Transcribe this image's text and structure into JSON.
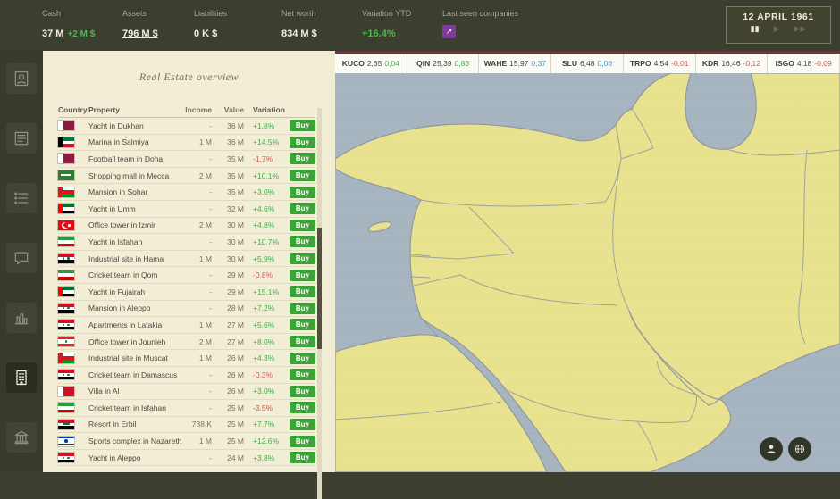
{
  "topbar": {
    "stats": [
      {
        "label": "Cash",
        "value": "37 M",
        "extra": "+2 M $"
      },
      {
        "label": "Assets",
        "value": "796 M $",
        "underline": true
      },
      {
        "label": "Liabilities",
        "value": "0 K $"
      },
      {
        "label": "Net worth",
        "value": "834 M $"
      },
      {
        "label": "Variation YTD",
        "value": "+16.4%",
        "positive": true
      },
      {
        "label": "Last seen companies",
        "button_icon": "↗"
      }
    ],
    "date": "12 APRIL 1961",
    "time_controls": {
      "pause": "▮▮",
      "play": "▶",
      "fast_forward": "▶▶"
    }
  },
  "ticker": [
    {
      "name": "KUCO",
      "price": "2,65",
      "change": "0,04",
      "color": "#3fae49"
    },
    {
      "name": "QIN",
      "price": "25,39",
      "change": "0,83",
      "color": "#3fae49"
    },
    {
      "name": "WAHE",
      "price": "15,97",
      "change": "0,37",
      "color": "#4596c7"
    },
    {
      "name": "SLU",
      "price": "6,48",
      "change": "0,06",
      "color": "#4596c7"
    },
    {
      "name": "TRPO",
      "price": "4,54",
      "change": "-0,01",
      "color": "#cd5a4e"
    },
    {
      "name": "KDR",
      "price": "16,46",
      "change": "-0,12",
      "color": "#cd5a4e"
    },
    {
      "name": "ISGO",
      "price": "4,18",
      "change": "-0,09",
      "color": "#cd5a4e"
    }
  ],
  "sidebar": {
    "items": [
      {
        "name": "profile",
        "icon": "portrait",
        "active": false
      },
      {
        "name": "news",
        "icon": "news",
        "active": false
      },
      {
        "name": "contracts",
        "icon": "list",
        "active": false
      },
      {
        "name": "messages",
        "icon": "chat",
        "active": false
      },
      {
        "name": "markets",
        "icon": "chart",
        "active": false
      },
      {
        "name": "real-estate",
        "icon": "building",
        "active": true
      },
      {
        "name": "bank",
        "icon": "bank",
        "active": false
      }
    ]
  },
  "panel": {
    "title": "Real Estate overview",
    "columns": [
      "Country",
      "Property",
      "Income",
      "Value",
      "Variation"
    ],
    "buy_label": "Buy",
    "rows": [
      {
        "flag": "qatar",
        "property": "Yacht in Dukhan",
        "income": "-",
        "value": "36 M",
        "variation": "+1.8%"
      },
      {
        "flag": "kuwait",
        "property": "Marina in Salmiya",
        "income": "1 M",
        "value": "36 M",
        "variation": "+14.5%"
      },
      {
        "flag": "qatar",
        "property": "Football team in Doha",
        "income": "-",
        "value": "35 M",
        "variation": "-1.7%"
      },
      {
        "flag": "saudi",
        "property": "Shopping mall in Mecca",
        "income": "2 M",
        "value": "35 M",
        "variation": "+10.1%"
      },
      {
        "flag": "oman",
        "property": "Mansion in Sohar",
        "income": "-",
        "value": "35 M",
        "variation": "+3.0%"
      },
      {
        "flag": "uae",
        "property": "Yacht in Umm",
        "income": "-",
        "value": "32 M",
        "variation": "+4.6%"
      },
      {
        "flag": "turkey",
        "property": "Office tower in Izmir",
        "income": "2 M",
        "value": "30 M",
        "variation": "+4.8%"
      },
      {
        "flag": "iran",
        "property": "Yacht in Isfahan",
        "income": "-",
        "value": "30 M",
        "variation": "+10.7%"
      },
      {
        "flag": "syria",
        "property": "Industrial site in Hama",
        "income": "1 M",
        "value": "30 M",
        "variation": "+5.9%"
      },
      {
        "flag": "iran",
        "property": "Cricket team in Qom",
        "income": "-",
        "value": "29 M",
        "variation": "-0.8%"
      },
      {
        "flag": "uae",
        "property": "Yacht in Fujairah",
        "income": "-",
        "value": "29 M",
        "variation": "+15.1%"
      },
      {
        "flag": "syria",
        "property": "Mansion in Aleppo",
        "income": "-",
        "value": "28 M",
        "variation": "+7.2%"
      },
      {
        "flag": "syria",
        "property": "Apartments in Latakia",
        "income": "1 M",
        "value": "27 M",
        "variation": "+5.6%"
      },
      {
        "flag": "lebanon",
        "property": "Office tower in Jounieh",
        "income": "2 M",
        "value": "27 M",
        "variation": "+8.0%"
      },
      {
        "flag": "oman",
        "property": "Industrial site in Muscat",
        "income": "1 M",
        "value": "26 M",
        "variation": "+4.3%"
      },
      {
        "flag": "syria",
        "property": "Cricket team in Damascus",
        "income": "-",
        "value": "26 M",
        "variation": "-0.3%"
      },
      {
        "flag": "bahrain",
        "property": "Villa in Al",
        "income": "-",
        "value": "26 M",
        "variation": "+3.0%"
      },
      {
        "flag": "iran",
        "property": "Cricket team in Isfahan",
        "income": "-",
        "value": "25 M",
        "variation": "-3.5%"
      },
      {
        "flag": "iraq",
        "property": "Resort in Erbil",
        "income": "738 K",
        "value": "25 M",
        "variation": "+7.7%"
      },
      {
        "flag": "israel",
        "property": "Sports complex in Nazareth",
        "income": "1 M",
        "value": "25 M",
        "variation": "+12.6%"
      },
      {
        "flag": "syria",
        "property": "Yacht in Aleppo",
        "income": "-",
        "value": "24 M",
        "variation": "+3.8%"
      }
    ]
  },
  "flags": {
    "qatar": [
      [
        0,
        0,
        100,
        100,
        "#8d1b3d"
      ],
      [
        0,
        0,
        32,
        100,
        "#ffffff"
      ]
    ],
    "kuwait": [
      [
        0,
        0,
        100,
        34,
        "#007a3d"
      ],
      [
        0,
        34,
        100,
        33,
        "#ffffff"
      ],
      [
        0,
        67,
        100,
        33,
        "#ce1126"
      ],
      [
        0,
        0,
        26,
        100,
        "#000000"
      ]
    ],
    "saudi": [
      [
        0,
        0,
        100,
        100,
        "#2f7d33"
      ],
      [
        16,
        40,
        68,
        13,
        "#ffffff"
      ]
    ],
    "oman": [
      [
        0,
        0,
        100,
        34,
        "#ffffff"
      ],
      [
        0,
        34,
        100,
        33,
        "#db161b"
      ],
      [
        0,
        67,
        100,
        33,
        "#009025"
      ],
      [
        0,
        0,
        26,
        100,
        "#db161b"
      ]
    ],
    "uae": [
      [
        0,
        0,
        100,
        34,
        "#00732f"
      ],
      [
        0,
        34,
        100,
        33,
        "#ffffff"
      ],
      [
        0,
        67,
        100,
        33,
        "#000000"
      ],
      [
        0,
        0,
        26,
        100,
        "#ff0000"
      ]
    ],
    "turkey": [
      [
        0,
        0,
        100,
        100,
        "#e30a17"
      ],
      [
        22,
        18,
        46,
        64,
        "#ffffff",
        1
      ],
      [
        34,
        24,
        38,
        52,
        "#e30a17",
        1
      ],
      [
        62,
        38,
        14,
        24,
        "#ffffff",
        1
      ]
    ],
    "iran": [
      [
        0,
        0,
        100,
        34,
        "#239f40"
      ],
      [
        0,
        34,
        100,
        33,
        "#ffffff"
      ],
      [
        0,
        67,
        100,
        33,
        "#da0000"
      ]
    ],
    "syria": [
      [
        0,
        0,
        100,
        34,
        "#ce1126"
      ],
      [
        0,
        34,
        100,
        33,
        "#ffffff"
      ],
      [
        0,
        67,
        100,
        33,
        "#000000"
      ],
      [
        28,
        40,
        12,
        20,
        "#007a3d",
        1
      ],
      [
        58,
        40,
        12,
        20,
        "#007a3d",
        1
      ]
    ],
    "lebanon": [
      [
        0,
        0,
        100,
        30,
        "#ed1c24"
      ],
      [
        0,
        30,
        100,
        40,
        "#ffffff"
      ],
      [
        0,
        70,
        100,
        30,
        "#ed1c24"
      ],
      [
        42,
        34,
        16,
        32,
        "#00a651"
      ]
    ],
    "bahrain": [
      [
        0,
        0,
        100,
        100,
        "#ce1126"
      ],
      [
        0,
        0,
        32,
        100,
        "#ffffff"
      ]
    ],
    "iraq": [
      [
        0,
        0,
        100,
        34,
        "#ce1126"
      ],
      [
        0,
        34,
        100,
        33,
        "#ffffff"
      ],
      [
        0,
        67,
        100,
        33,
        "#000000"
      ],
      [
        30,
        40,
        40,
        18,
        "#007a3d"
      ]
    ],
    "israel": [
      [
        0,
        0,
        100,
        100,
        "#ffffff"
      ],
      [
        0,
        10,
        100,
        14,
        "#0038b8"
      ],
      [
        0,
        76,
        100,
        14,
        "#0038b8"
      ],
      [
        40,
        34,
        20,
        32,
        "#0038b8",
        1
      ]
    ]
  },
  "map": {
    "sea": "#a6b4c0",
    "land": "#e8e18e",
    "border": "#8e979e"
  },
  "colors": {
    "positive": "#3fae49",
    "negative": "#cd5a4e",
    "buy_green": "#3da339",
    "purple": "#7d3c98",
    "ticker_accent": "#7c2d36"
  }
}
